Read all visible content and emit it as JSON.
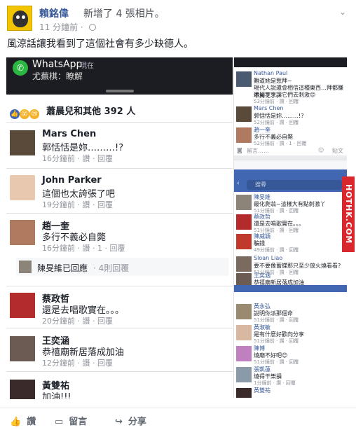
{
  "header": {
    "author": "賴銘偉",
    "action": "新增了 4 張相片。",
    "time": "11 分鐘前 · ",
    "menu_icon": "chevron-down-icon"
  },
  "caption": "風涼話讓我看到了這個社會有多少缺德人。",
  "left_shot": {
    "notification": {
      "app": "WhatsApp",
      "when": "現在",
      "message": "尤蕪棋：瞭解"
    },
    "reactions": {
      "summary": "蕭晨兒和其他 392 人"
    },
    "comments": [
      {
        "name": "Mars Chen",
        "text": "郭恬恬是妳………!?",
        "meta": "16分鐘前 · 讚 · 回覆"
      },
      {
        "name": "John Parker",
        "text": "這個也太誇張了吧",
        "meta": "19分鐘前 · 讚 · 回覆"
      },
      {
        "name": "趙一奎",
        "text": "多行不義必自斃",
        "meta": "16分鐘前 · 讚 · 1 · 回覆"
      },
      {
        "name": "蔡政哲",
        "text": "還是去唱歌實在。。。",
        "meta": "20分鐘前 · 讚 · 回覆"
      },
      {
        "name": "王奕涵",
        "text": "恭禧廟新居落成加油",
        "meta": "12分鐘前 · 讚 · 回覆"
      },
      {
        "name": "黃雙祐",
        "text": "加油!!!",
        "meta": ""
      }
    ],
    "reply": {
      "text": "陳旻維已回應",
      "count": "· 4則回覆"
    }
  },
  "right_shot": {
    "items_top": [
      {
        "name": "Nathan Paul",
        "text": "難道她是惹拜~",
        "text2": "現代人說還會相信這種東西…拜都賺不夠花了，",
        "text3": "還留下來讓它們去刺激😊",
        "meta": "53分鐘前 · 讚 · 回覆"
      },
      {
        "name": "Mars Chen",
        "text": "郭恬恬是妳………!?",
        "meta": "52分鐘前 · 讚 · 回覆"
      },
      {
        "name": "趙一奎",
        "text": "多行不義必自斃",
        "meta": "52分鐘前 · 讚 · 1 · 回覆"
      }
    ],
    "comment_box": "留言……",
    "post_btn": "貼文",
    "search_placeholder": "搜尋",
    "items_bottom": [
      {
        "name": "陳旻維",
        "text": "最化爬翁~這樣大有點刺激丫",
        "meta": "51分鐘前 · 讚 · 回覆"
      },
      {
        "name": "蔡政哲",
        "text": "還是去唱歌實在。。。",
        "meta": "51分鐘前 · 讚 · 回覆"
      },
      {
        "name": "陳威穎",
        "text": "騙錢",
        "meta": "49分鐘前 · 讚 · 回覆"
      },
      {
        "name": "Sloan Liao",
        "text": "要不要像蓄蝶那只至少放火燒看看?",
        "meta": "51分鐘前 · 讚 · 回覆"
      },
      {
        "name": "王奕涵",
        "text": "恭禧廟新居落成加油",
        "meta": "51分鐘前 · 讚 · 回覆"
      },
      {
        "name": "黃永弘",
        "text": "說明你派那個命",
        "meta": "51分鐘前 · 讚 · 回覆"
      },
      {
        "name": "黃淑敏",
        "text": "是有什麼好歡向分享",
        "meta": "51分鐘前 · 讚 · 回覆"
      },
      {
        "name": "陳博",
        "text": "燒廟不好吧😊",
        "meta": "51分鐘前 · 讚 · 回覆"
      },
      {
        "name": "張凱蓮",
        "text": "燒得干樂損",
        "meta": "1分鐘前 · 讚 · 回覆"
      },
      {
        "name": "黃雙祐",
        "text": "",
        "meta": ""
      }
    ]
  },
  "watermark": "HOTHK.COM",
  "footer": {
    "like": "讚",
    "comment": "留言",
    "share": "分享"
  }
}
